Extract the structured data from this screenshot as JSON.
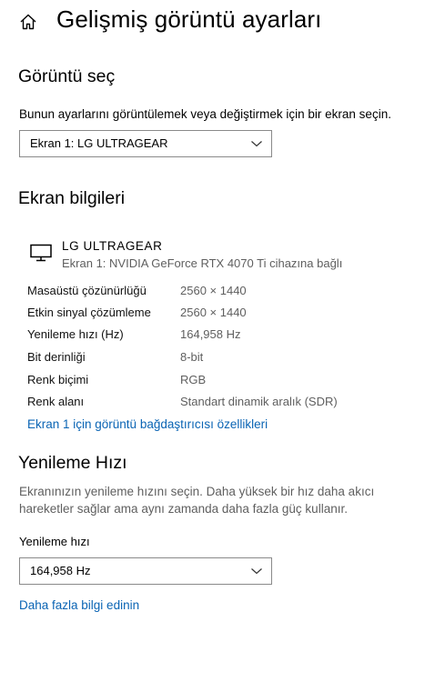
{
  "header": {
    "home_icon": "home-icon",
    "title": "Gelişmiş görüntü ayarları"
  },
  "choose_display": {
    "title": "Görüntü seç",
    "description": "Bunun ayarlarını görüntülemek veya değiştirmek için bir ekran seçin.",
    "selected_display": "Ekran 1: LG ULTRAGEAR"
  },
  "display_info": {
    "title": "Ekran bilgileri",
    "monitor_icon": "monitor-icon",
    "display_name": "LG ULTRAGEAR",
    "display_subtitle": "Ekran 1: NVIDIA GeForce RTX 4070 Ti cihazına bağlı",
    "rows": [
      {
        "label": "Masaüstü çözünürlüğü",
        "value": "2560 × 1440"
      },
      {
        "label": "Etkin sinyal çözümleme",
        "value": "2560 × 1440"
      },
      {
        "label": "Yenileme hızı (Hz)",
        "value": "164,958 Hz"
      },
      {
        "label": "Bit derinliği",
        "value": "8-bit"
      },
      {
        "label": "Renk biçimi",
        "value": "RGB"
      },
      {
        "label": "Renk alanı",
        "value": "Standart dinamik aralık (SDR)"
      }
    ],
    "adapter_link": "Ekran 1 için görüntü bağdaştırıcısı özellikleri"
  },
  "refresh_rate": {
    "title": "Yenileme Hızı",
    "description": "Ekranınızın yenileme hızını seçin. Daha yüksek bir hız daha akıcı hareketler sağlar ama aynı zamanda daha fazla güç kullanır.",
    "dropdown_label": "Yenileme hızı",
    "selected_rate": "164,958 Hz",
    "more_info_link": "Daha fazla bilgi edinin"
  },
  "colors": {
    "link": "#0a64b4",
    "muted_text": "#5f5f5f",
    "border": "#8a8a8a"
  }
}
